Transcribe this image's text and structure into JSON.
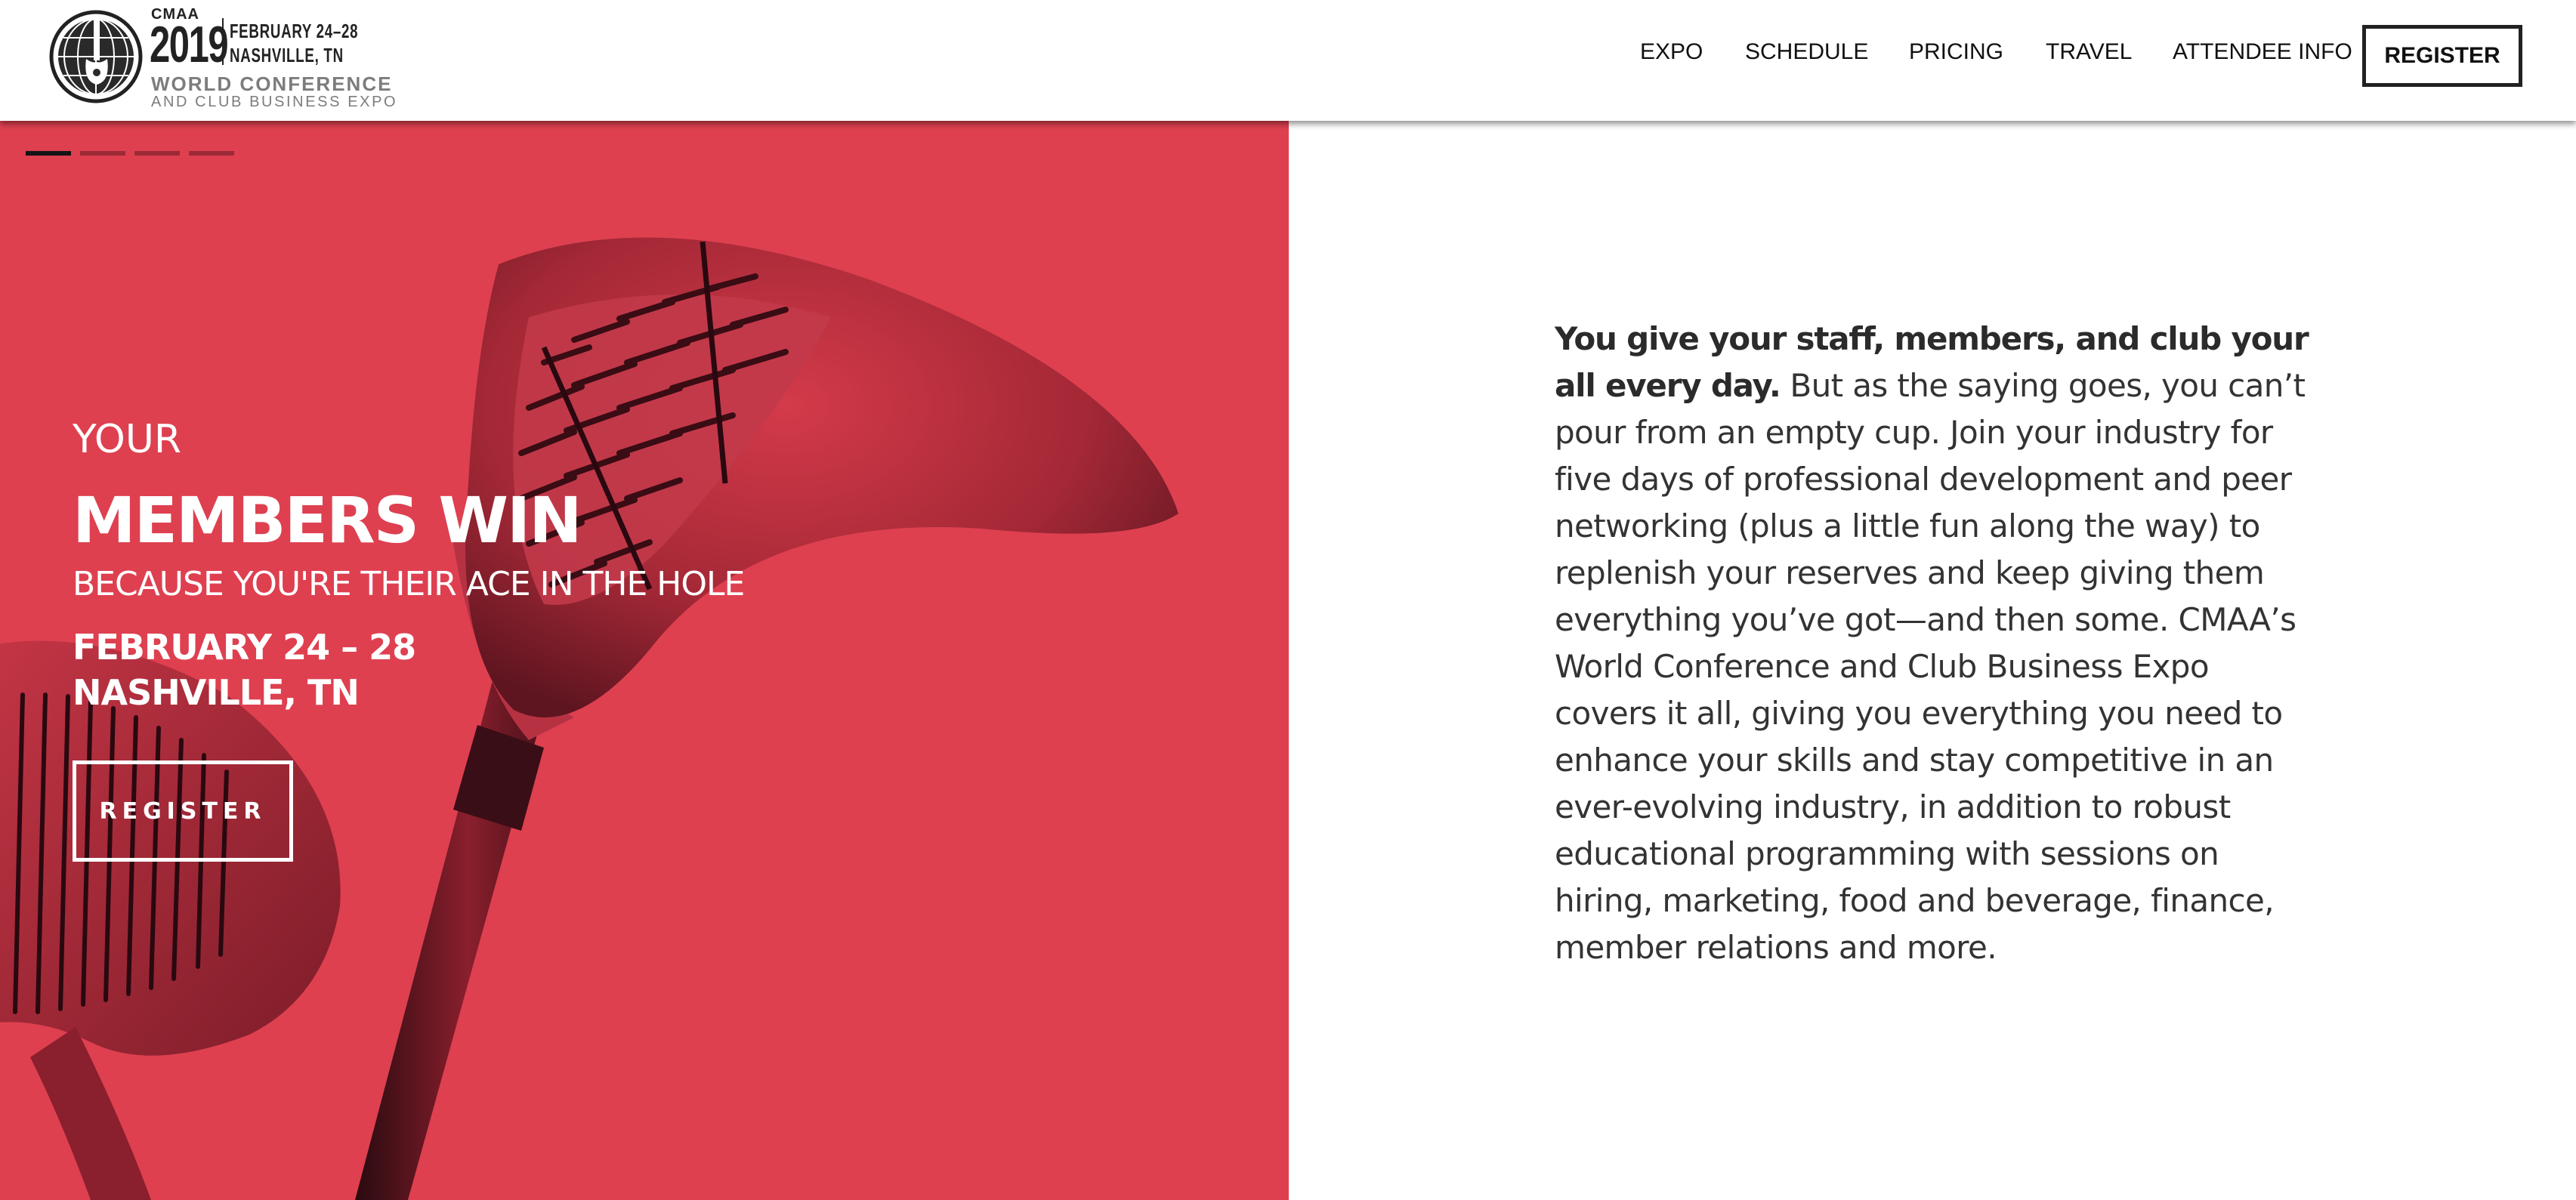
{
  "logo": {
    "org": "CMAA",
    "year": "2019",
    "dates": "FEBRUARY 24–28",
    "location": "NASHVILLE, TN",
    "line1": "WORLD CONFERENCE",
    "line2": "AND CLUB BUSINESS EXPO"
  },
  "nav": {
    "items": [
      "EXPO",
      "SCHEDULE",
      "PRICING",
      "TRAVEL",
      "ATTENDEE INFO"
    ],
    "register_label": "REGISTER"
  },
  "hero": {
    "slider": {
      "count": 4,
      "active_index": 0
    },
    "eyebrow": "YOUR",
    "headline": "MEMBERS WIN",
    "subheadline": "BECAUSE YOU'RE THEIR ACE IN THE HOLE",
    "dates": "FEBRUARY 24 – 28",
    "location": "NASHVILLE, TN",
    "register_label": "REGISTER"
  },
  "intro": {
    "lead_bold": "You give your staff, members, and club your all every day.",
    "body": " But as the saying goes, you can’t pour from an empty cup. Join your industry for five days of professional development and peer networking (plus a little fun along the way) to replenish your reserves and keep giving them everything you’ve got—and then some. CMAA’s World Conference and Club Business Expo covers it all, giving you everything you need to enhance your skills and stay competitive in an ever-evolving industry, in addition to robust educational programming with sessions on hiring, marketing, food and beverage, finance, member relations and more."
  },
  "colors": {
    "hero_red": "#de4050",
    "text_dark": "#333333",
    "border": "#222222"
  }
}
